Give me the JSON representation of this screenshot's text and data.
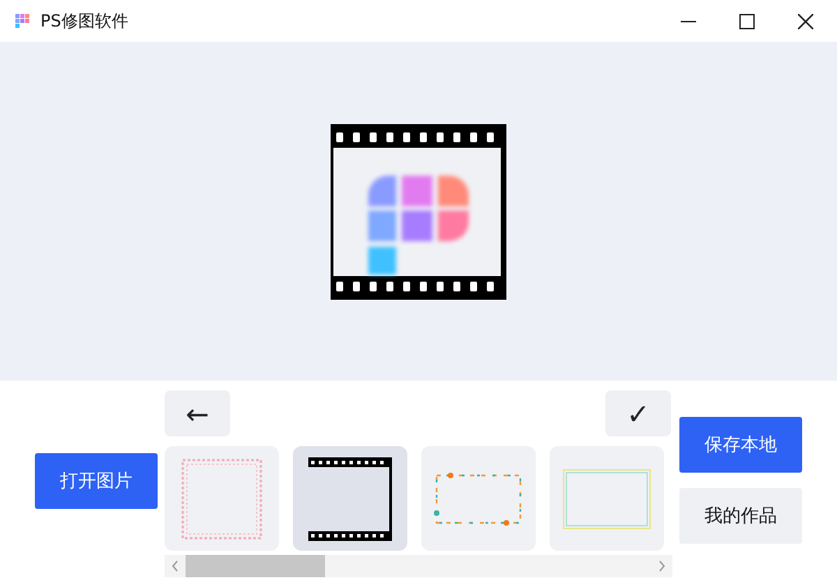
{
  "window": {
    "title": "PS修图软件"
  },
  "toolbar": {
    "back_button": "←",
    "confirm_button": "✓"
  },
  "open_button": "打开图片",
  "frames": [
    {
      "kind": "dotted",
      "selected": false
    },
    {
      "kind": "film",
      "selected": true
    },
    {
      "kind": "floral",
      "selected": false
    },
    {
      "kind": "thin",
      "selected": false
    }
  ],
  "save_button": "保存本地",
  "works_button": "我的作品"
}
